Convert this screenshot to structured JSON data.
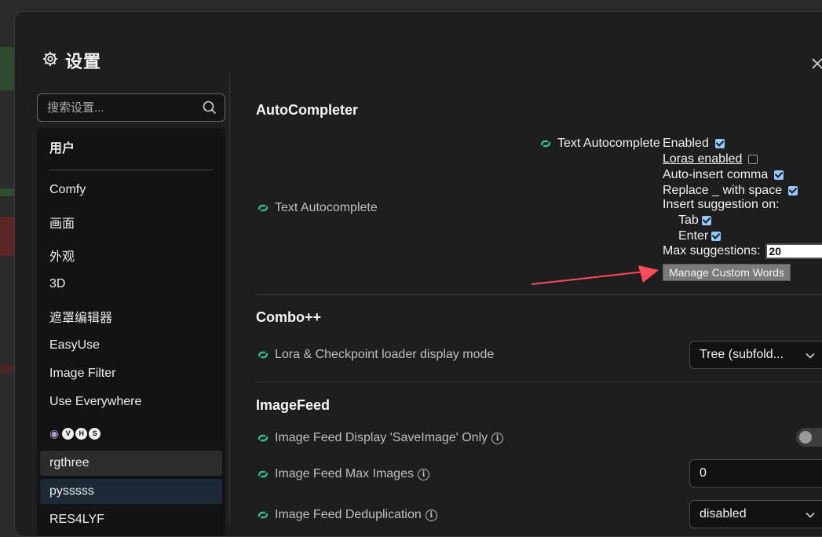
{
  "dialog": {
    "title": "设置"
  },
  "search": {
    "placeholder": "搜索设置..."
  },
  "sidebar": {
    "items": [
      {
        "label": "用户"
      },
      {
        "label": "Comfy"
      },
      {
        "label": "画面"
      },
      {
        "label": "外观"
      },
      {
        "label": "3D"
      },
      {
        "label": "遮罩编辑器"
      },
      {
        "label": "EasyUse"
      },
      {
        "label": "Image Filter"
      },
      {
        "label": "Use Everywhere"
      },
      {
        "label": "VHS",
        "letters": [
          "V",
          "H",
          "S"
        ]
      },
      {
        "label": "rgthree"
      },
      {
        "label": "pysssss"
      },
      {
        "label": "RES4LYF"
      }
    ]
  },
  "sections": {
    "autocompleter": {
      "title": "AutoCompleter",
      "row_label": "Text Autocomplete",
      "panel": {
        "heading": "Text Autocomplete",
        "enabled": {
          "label": "Enabled",
          "checked": true
        },
        "loras": {
          "label": "Loras enabled",
          "checked": false
        },
        "auto_comma": {
          "label": "Auto-insert comma",
          "checked": true
        },
        "replace_underscore": {
          "label": "Replace _ with space",
          "checked": true
        },
        "insert_on": {
          "label": "Insert suggestion on:"
        },
        "tab": {
          "label": "Tab",
          "checked": true
        },
        "enter": {
          "label": "Enter",
          "checked": true
        },
        "max_suggestions": {
          "label": "Max suggestions:",
          "value": "20"
        },
        "manage_button": "Manage Custom Words"
      }
    },
    "combo": {
      "title": "Combo++",
      "row_label": "Lora & Checkpoint loader display mode",
      "select_value": "Tree (subfold..."
    },
    "imagefeed": {
      "title": "ImageFeed",
      "rows": [
        {
          "label": "Image Feed Display 'SaveImage' Only",
          "toggle": false
        },
        {
          "label": "Image Feed Max Images",
          "value": "0"
        },
        {
          "label": "Image Feed Deduplication",
          "value": "disabled"
        }
      ]
    }
  },
  "colors": {
    "accent": "#2fc08f",
    "checkbox": "#90c8ff",
    "arrow": "#ff4a5a"
  }
}
